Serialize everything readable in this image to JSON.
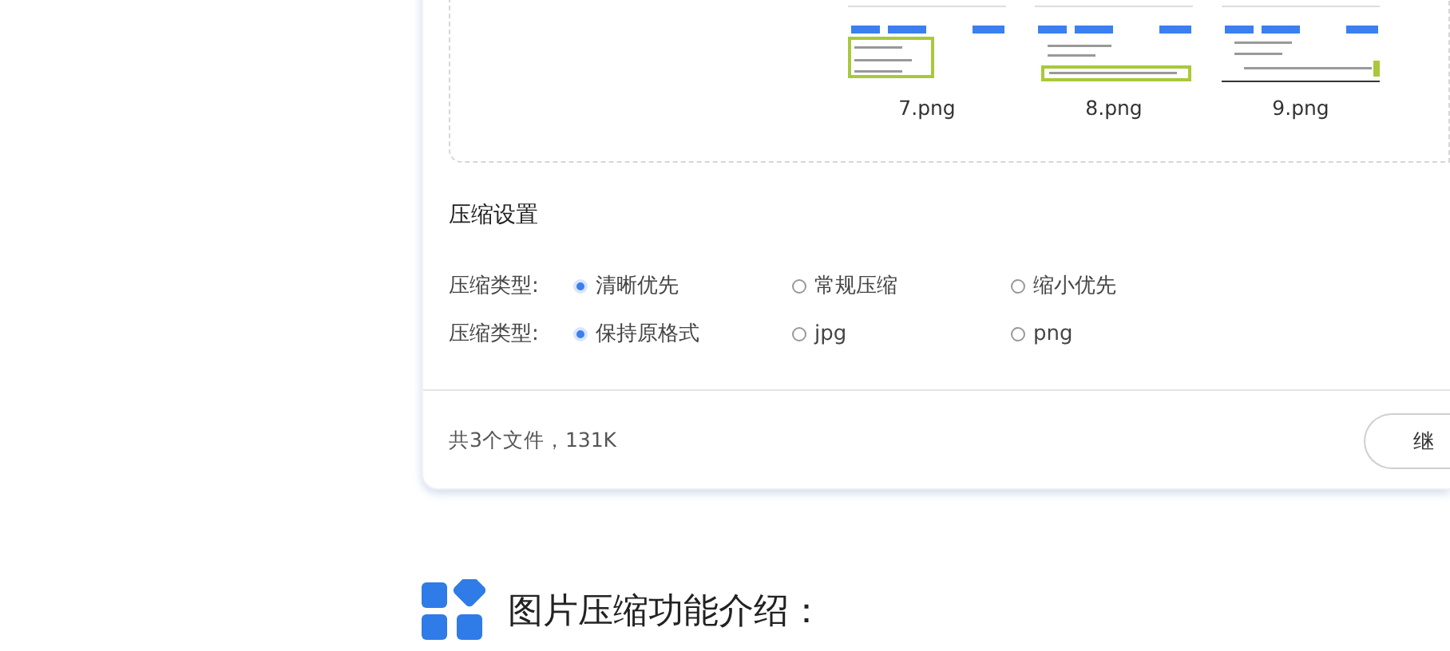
{
  "upload": {
    "files": [
      {
        "name": "7.png",
        "kind": "table"
      },
      {
        "name": "8.png",
        "kind": "form"
      },
      {
        "name": "9.png",
        "kind": "list"
      }
    ]
  },
  "settings": {
    "title": "压缩设置",
    "rows": [
      {
        "label": "压缩类型:",
        "options": [
          {
            "label": "清晰优先",
            "selected": true
          },
          {
            "label": "常规压缩",
            "selected": false
          },
          {
            "label": "缩小优先",
            "selected": false
          }
        ]
      },
      {
        "label": "压缩类型:",
        "options": [
          {
            "label": "保持原格式",
            "selected": true
          },
          {
            "label": "jpg",
            "selected": false
          },
          {
            "label": "png",
            "selected": false
          }
        ]
      }
    ]
  },
  "footer": {
    "summary": "共3个文件，131K",
    "button": "继"
  },
  "intro": {
    "heading": "图片压缩功能介绍："
  }
}
